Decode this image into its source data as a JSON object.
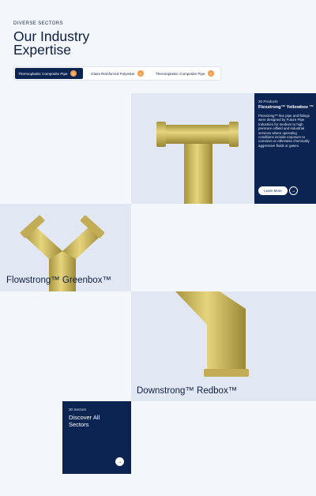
{
  "header": {
    "eyebrow": "DIVERSE SECTORS",
    "title": "Our Industry Expertise"
  },
  "tabs": [
    {
      "label": "Thermoplastic Composite Pipe",
      "badge": "3",
      "active": true
    },
    {
      "label": "Glass Reinforced Polyester",
      "badge": "3",
      "active": false
    },
    {
      "label": "Thermoplastic Composite Pipe",
      "badge": "3",
      "active": false
    }
  ],
  "featured": {
    "count": "30 Products",
    "name": "Flexstrong™ Yellowbox ™",
    "description": "Flexstrong™ line pipe and fittings were designed by Future Pipe Industries for medium to high pressure oilfield and industrial services where operating conditions include exposure to corrosive or otherwise chemically aggressive fluids or gases.",
    "learn_more": "Learn More"
  },
  "products": [
    {
      "name": "Flowstrong™ Greenbox™"
    },
    {
      "name": "Downstrong™ Redbox™"
    }
  ],
  "sectors_card": {
    "count": "30 Sectors",
    "title": "Discover All Sectors"
  },
  "colors": {
    "navy": "#0b2452",
    "pipe": "#d9c56b",
    "badge": "#f0a04b",
    "panel": "#e2e8f3"
  },
  "icons": {
    "arrow": "arrow-right-icon"
  }
}
